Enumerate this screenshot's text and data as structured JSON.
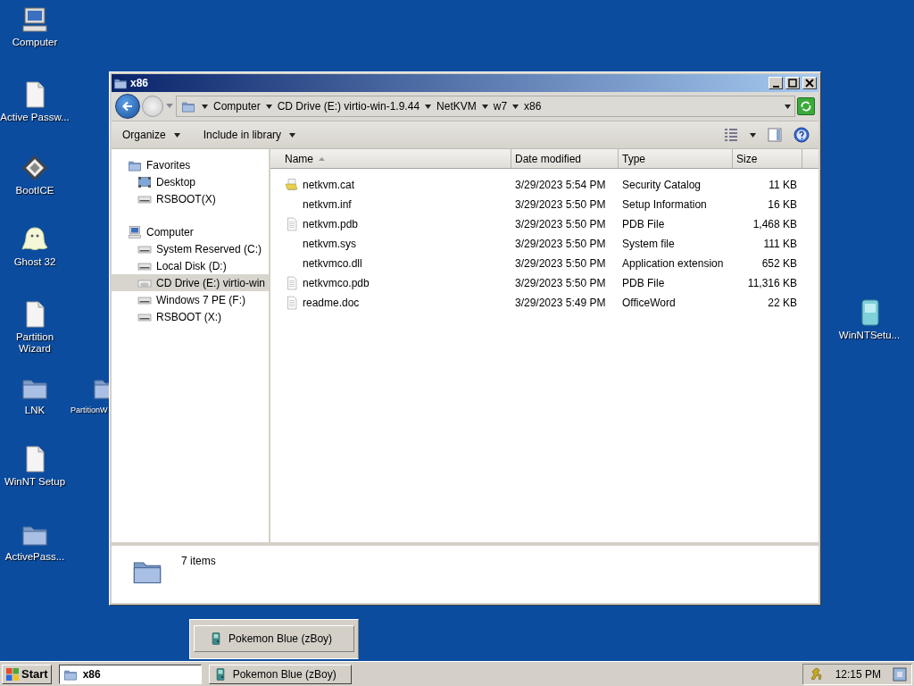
{
  "desktop_icons": [
    {
      "label": "Computer",
      "kind": "computer"
    },
    {
      "label": "Active Passw...",
      "kind": "document"
    },
    {
      "label": "BootICE",
      "kind": "floppy"
    },
    {
      "label": "Ghost 32",
      "kind": "ghost"
    },
    {
      "label": "Partition Wizard",
      "kind": "document"
    },
    {
      "label": "LNK",
      "kind": "folder"
    },
    {
      "label": "PartitionW",
      "kind": "folder"
    },
    {
      "label": "WinNT Setup",
      "kind": "document"
    },
    {
      "label": "ActivePass...",
      "kind": "folder"
    },
    {
      "label": "WinNTSetu...",
      "kind": "setup"
    }
  ],
  "window": {
    "title": "x86",
    "breadcrumb": [
      "Computer",
      "CD Drive (E:) virtio-win-1.9.44",
      "NetKVM",
      "w7",
      "x86"
    ],
    "toolbar": [
      "Organize",
      "Include in library"
    ],
    "nav": [
      {
        "label": "Favorites",
        "kind": "favorites",
        "children": [
          {
            "label": "Desktop",
            "kind": "desktop",
            "selected": false
          },
          {
            "label": "RSBOOT(X)",
            "kind": "drive",
            "selected": false
          }
        ]
      },
      {
        "label": "Computer",
        "kind": "computer",
        "children": [
          {
            "label": "System Reserved (C:)",
            "kind": "drive",
            "selected": false
          },
          {
            "label": "Local Disk (D:)",
            "kind": "drive",
            "selected": false
          },
          {
            "label": "CD Drive (E:) virtio-win",
            "kind": "cd",
            "selected": true
          },
          {
            "label": "Windows 7 PE (F:)",
            "kind": "drive",
            "selected": false
          },
          {
            "label": "RSBOOT (X:)",
            "kind": "drive",
            "selected": false
          }
        ]
      }
    ],
    "columns": [
      {
        "label": "Name",
        "sorted": true
      },
      {
        "label": "Date modified",
        "sorted": false
      },
      {
        "label": "Type",
        "sorted": false
      },
      {
        "label": "Size",
        "sorted": false
      }
    ],
    "files": [
      {
        "name": "netkvm.cat",
        "date": "3/29/2023 5:54 PM",
        "type": "Security Catalog",
        "size": "11 KB",
        "kind": "catalog"
      },
      {
        "name": "netkvm.inf",
        "date": "3/29/2023 5:50 PM",
        "type": "Setup Information",
        "size": "16 KB"
      },
      {
        "name": "netkvm.pdb",
        "date": "3/29/2023 5:50 PM",
        "type": "PDB File",
        "size": "1,468 KB",
        "kind": "file"
      },
      {
        "name": "netkvm.sys",
        "date": "3/29/2023 5:50 PM",
        "type": "System file",
        "size": "111 KB"
      },
      {
        "name": "netkvmco.dll",
        "date": "3/29/2023 5:50 PM",
        "type": "Application extension",
        "size": "652 KB"
      },
      {
        "name": "netkvmco.pdb",
        "date": "3/29/2023 5:50 PM",
        "type": "PDB File",
        "size": "11,316 KB",
        "kind": "file"
      },
      {
        "name": "readme.doc",
        "date": "3/29/2023 5:49 PM",
        "type": "OfficeWord",
        "size": "22 KB",
        "kind": "file"
      }
    ],
    "status": "7 items"
  },
  "thumbnail": {
    "label": "Pokemon Blue (zBoy)"
  },
  "taskbar": {
    "start": "Start",
    "tasks": [
      {
        "label": "x86",
        "kind": "folder",
        "selected": true
      },
      {
        "label": "Pokemon Blue (zBoy)",
        "kind": "app",
        "selected": false
      }
    ],
    "clock": "12:15 PM"
  }
}
